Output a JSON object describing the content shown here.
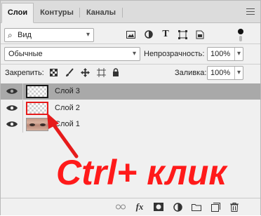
{
  "tabs": [
    {
      "label": "Слои",
      "active": true
    },
    {
      "label": "Контуры",
      "active": false
    },
    {
      "label": "Каналы",
      "active": false
    }
  ],
  "filter": {
    "search_glyph": "⌕",
    "kind_label": "Вид"
  },
  "blend": {
    "mode": "Обычные",
    "opacity_label": "Непрозрачность:",
    "opacity_value": "100%"
  },
  "lock": {
    "label": "Закрепить:",
    "fill_label": "Заливка:",
    "fill_value": "100%"
  },
  "layers": [
    {
      "name": "Слой 3",
      "selected": true,
      "thumb": "transparent"
    },
    {
      "name": "Слой 2",
      "selected": false,
      "thumb": "transparent-highlighted"
    },
    {
      "name": "Слой 1",
      "selected": false,
      "thumb": "eyes-photo"
    }
  ],
  "overlay": {
    "text": "Ctrl+ клик",
    "color": "#ff1a1a"
  },
  "bottom_icons": [
    "link-icon",
    "fx-icon",
    "mask-icon",
    "adjustment-icon",
    "folder-icon",
    "new-layer-icon",
    "trash-icon"
  ],
  "colors": {
    "panel_bg": "#f0f0f0",
    "selected_layer_bg": "#a9a9a9",
    "accent_red": "#e61b1b"
  }
}
